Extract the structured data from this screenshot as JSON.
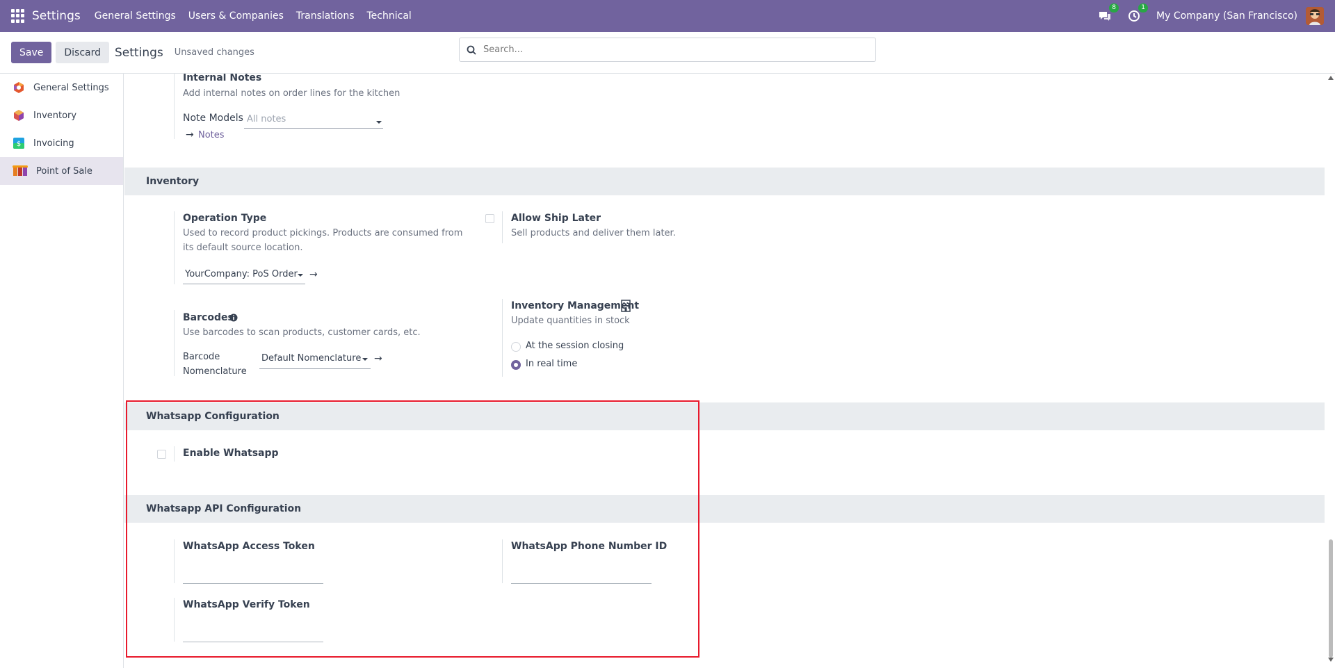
{
  "navbar": {
    "app_title": "Settings",
    "menus": [
      "General Settings",
      "Users & Companies",
      "Translations",
      "Technical"
    ],
    "messages_count": "8",
    "activities_count": "1",
    "company": "My Company (San Francisco)"
  },
  "control_panel": {
    "save_label": "Save",
    "discard_label": "Discard",
    "title": "Settings",
    "status": "Unsaved changes",
    "search_placeholder": "Search..."
  },
  "sidebar": {
    "items": [
      {
        "label": "General Settings",
        "icon": "general-settings-icon",
        "color": "#e4572e"
      },
      {
        "label": "Inventory",
        "icon": "inventory-icon",
        "color": "#d9534f"
      },
      {
        "label": "Invoicing",
        "icon": "invoicing-icon",
        "color": "#1fa2e0"
      },
      {
        "label": "Point of Sale",
        "icon": "point-of-sale-icon",
        "color": "#a66a2c"
      }
    ],
    "active_index": 3
  },
  "internal_notes": {
    "label": "Internal Notes",
    "description": "Add internal notes on order lines for the kitchen",
    "note_models_label": "Note Models",
    "note_models_placeholder": "All notes",
    "notes_link": "Notes"
  },
  "inventory": {
    "section_title": "Inventory",
    "operation_type": {
      "label": "Operation Type",
      "description_line1": "Used to record product pickings. Products are consumed from",
      "description_line2": "its default source location.",
      "value": "YourCompany: PoS Order"
    },
    "allow_ship_later": {
      "label": "Allow Ship Later",
      "description": "Sell products and deliver them later.",
      "checked": false
    },
    "barcodes": {
      "label": "Barcodes",
      "description": "Use barcodes to scan products, customer cards, etc.",
      "nomenclature_label_line1": "Barcode",
      "nomenclature_label_line2": "Nomenclature",
      "nomenclature_value": "Default Nomenclature"
    },
    "inventory_management": {
      "label": "Inventory Management",
      "description": "Update quantities in stock",
      "options": [
        "At the session closing",
        "In real time"
      ],
      "selected_index": 1
    }
  },
  "whatsapp": {
    "section_title": "Whatsapp Configuration",
    "enable_label": "Enable Whatsapp",
    "enabled": false
  },
  "whatsapp_api": {
    "section_title": "Whatsapp API Configuration",
    "access_token_label": "WhatsApp Access Token",
    "phone_number_id_label": "WhatsApp Phone Number ID",
    "verify_token_label": "WhatsApp Verify Token",
    "access_token_value": "",
    "phone_number_id_value": "",
    "verify_token_value": ""
  },
  "colors": {
    "brand": "#71639e",
    "highlight_border": "#e8192c",
    "badge": "#28a745"
  }
}
